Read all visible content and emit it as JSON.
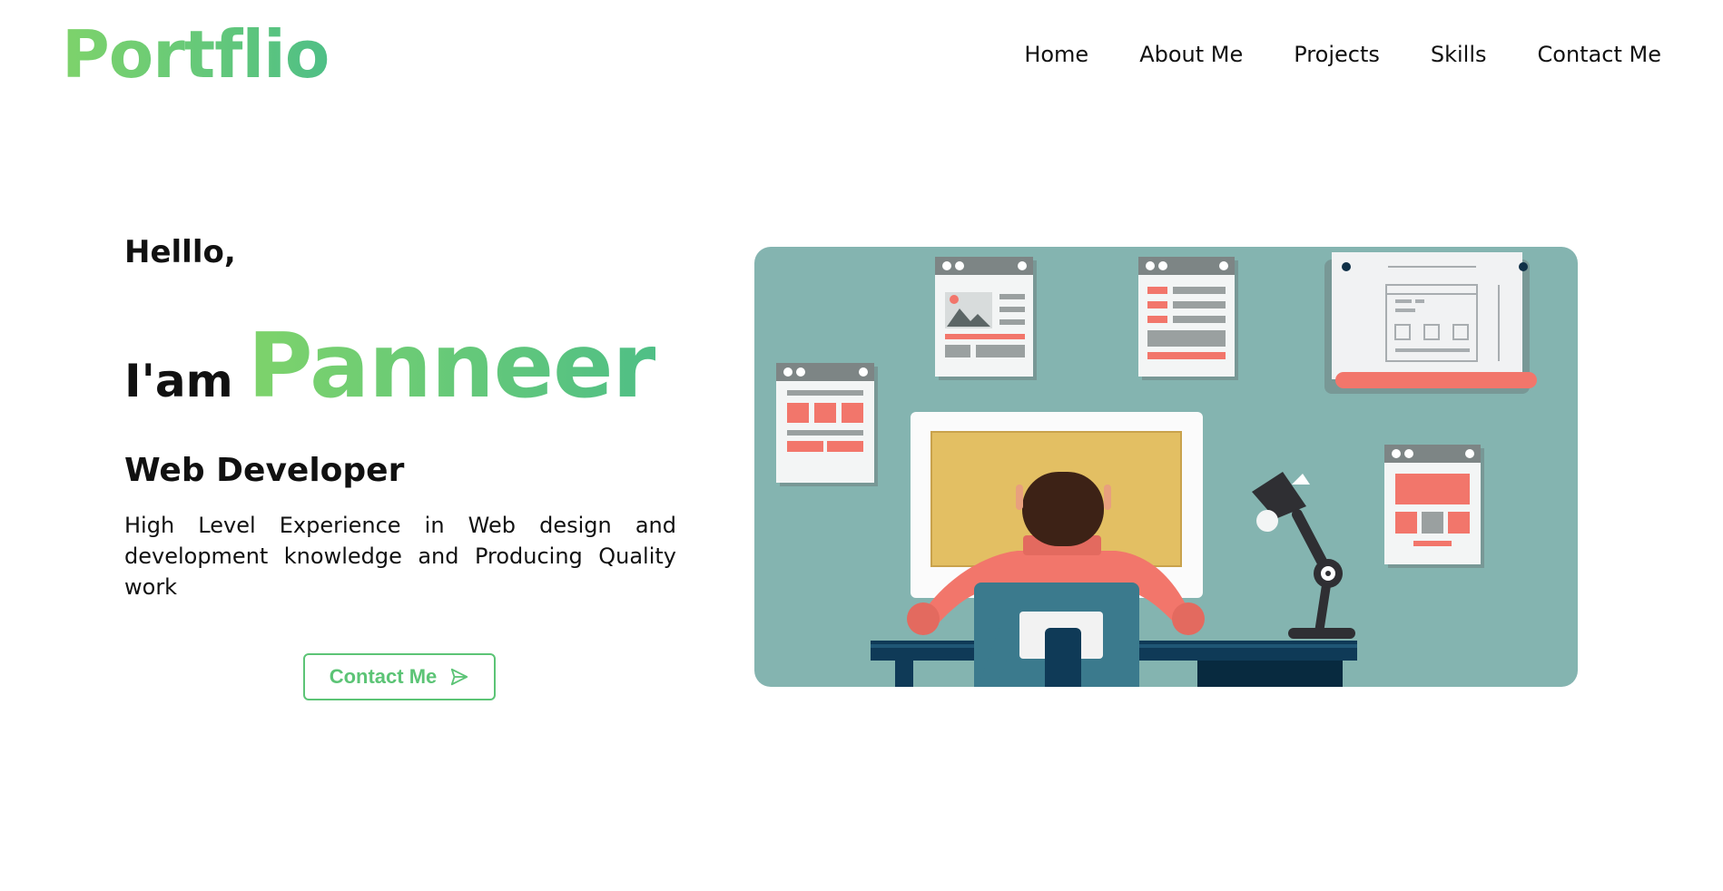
{
  "header": {
    "logo": "Portflio",
    "nav": [
      "Home",
      "About Me",
      "Projects",
      "Skills",
      "Contact Me"
    ]
  },
  "hero": {
    "greeting": "Helllo,",
    "intro_prefix": "I'am",
    "name": "Panneer",
    "role": "Web Developer",
    "description": "High Level Experience in Web design and development knowledge and Producing Quality work",
    "cta_label": "Contact Me",
    "cta_icon": "send-icon"
  },
  "colors": {
    "accent_start": "#7ed36b",
    "accent_end": "#4fbf86",
    "illustration_bg": "#84b4b0",
    "coral": "#f2766b",
    "navy": "#0f3a57"
  }
}
